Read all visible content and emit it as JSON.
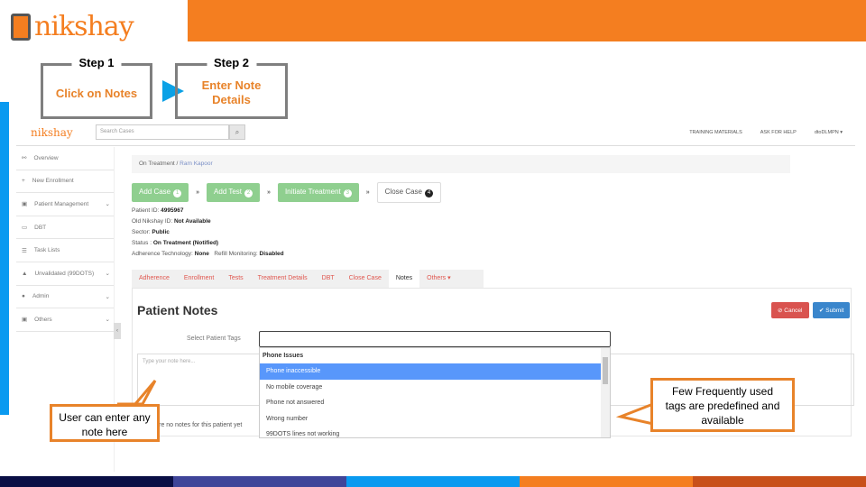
{
  "brand": {
    "logo_text": "nikshay",
    "accent": "#f47e20",
    "left_accent": "#0a9af0"
  },
  "steps": [
    {
      "title": "Step 1",
      "body": "Click on Notes"
    },
    {
      "title": "Step 2",
      "body": "Enter Note Details"
    }
  ],
  "app": {
    "logo_text": "nikshay",
    "search_placeholder": "Search Cases",
    "nav_right": [
      "TRAINING MATERIALS",
      "ASK FOR HELP",
      "dtoDLMPN ▾"
    ],
    "sidebar": [
      {
        "icon": "binoculars-icon",
        "glyph": "⚯",
        "label": "Overview"
      },
      {
        "icon": "plus-icon",
        "glyph": "+",
        "label": "New Enrollment"
      },
      {
        "icon": "briefcase-icon",
        "glyph": "▣",
        "label": "Patient Management",
        "chevron": true
      },
      {
        "icon": "money-icon",
        "glyph": "▭",
        "label": "DBT"
      },
      {
        "icon": "list-icon",
        "glyph": "☰",
        "label": "Task Lists"
      },
      {
        "icon": "warning-icon",
        "glyph": "▲",
        "label": "Unvalidated (99DOTS)",
        "chevron": true
      },
      {
        "icon": "user-icon",
        "glyph": "●",
        "label": "Admin",
        "chevron": true
      },
      {
        "icon": "briefcase-icon",
        "glyph": "▣",
        "label": "Others",
        "chevron": true
      }
    ],
    "breadcrumb": [
      "On Treatment",
      "Ram Kapoor"
    ],
    "workflow": [
      {
        "label": "Add Case",
        "num": "1"
      },
      {
        "label": "Add Test",
        "num": "2"
      },
      {
        "label": "Initiate Treatment",
        "num": "3"
      },
      {
        "label": "Close Case",
        "num": "4"
      }
    ],
    "patient": {
      "id_label": "Patient ID:",
      "id": "4995967",
      "old_label": "Old Nikshay ID:",
      "old": "Not Available",
      "sector_label": "Sector:",
      "sector": "Public",
      "status_label": "Status :",
      "status": "On Treatment (Notified)",
      "adh_label": "Adherence Technology:",
      "adh": "None",
      "refill_label": "Refill Monitoring:",
      "refill": "Disabled"
    },
    "tabs": [
      "Adherence",
      "Enrollment",
      "Tests",
      "Treatment Details",
      "DBT",
      "Close Case",
      "Notes",
      "Others ▾"
    ],
    "active_tab": "Notes",
    "notes": {
      "title": "Patient Notes",
      "cancel": "⊘ Cancel",
      "submit": "✔ Submit",
      "tags_label": "Select Patient Tags",
      "note_placeholder": "Type your note here...",
      "empty": "There are no notes for this patient yet",
      "dropdown_group": "Phone Issues",
      "dropdown_options": [
        "Phone inaccessible",
        "No mobile coverage",
        "Phone not answered",
        "Wrong number",
        "99DOTS lines not working"
      ],
      "highlighted": "Phone inaccessible"
    }
  },
  "callouts": {
    "left": "User can enter any note here",
    "right": "Few Frequently used tags are predefined and available"
  },
  "stripe_colors": [
    "#0a0f45",
    "#3f4599",
    "#0a9af0",
    "#f47e20",
    "#c8501a"
  ]
}
